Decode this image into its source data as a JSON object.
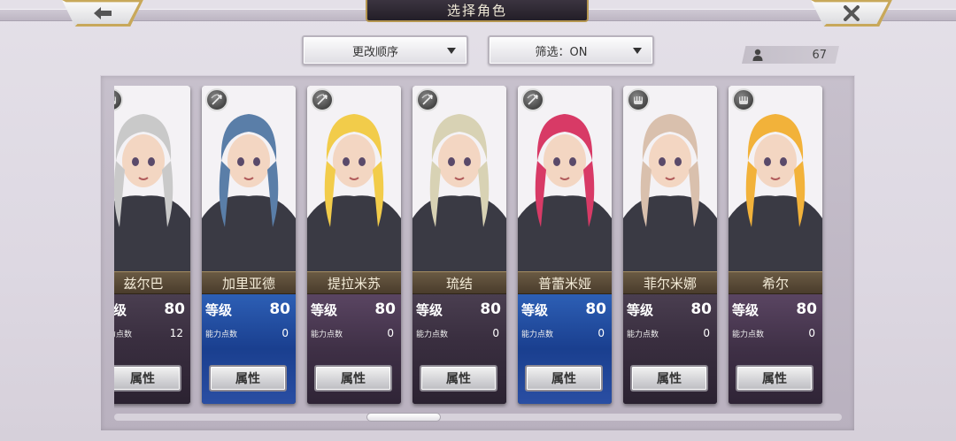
{
  "header": {
    "title": "选择角色",
    "back_icon": "back-arrow-icon",
    "close_icon": "close-x-icon"
  },
  "toolbar": {
    "sort_label": "更改顺序",
    "filter_label": "筛选：ON",
    "roster_count": "67"
  },
  "colors": {
    "gold_trim": "#c8a85a",
    "title_plate": "#2b252f",
    "blue_card": "#1a3f8f",
    "name_plate": "#5a4a38"
  },
  "labels": {
    "level": "等级",
    "ability_points": "能力点数",
    "attribute_button": "属性"
  },
  "characters": [
    {
      "name": "兹尔巴",
      "level": "80",
      "points": "12",
      "class_icon": "fist-icon",
      "hair": "#c9c9c9",
      "bg": "dark"
    },
    {
      "name": "加里亚德",
      "level": "80",
      "points": "0",
      "class_icon": "bow-icon",
      "hair": "#5a7ea8",
      "bg": "blue"
    },
    {
      "name": "提拉米苏",
      "level": "80",
      "points": "0",
      "class_icon": "bow-icon",
      "hair": "#f2cc4a",
      "bg": "purple"
    },
    {
      "name": "琉结",
      "level": "80",
      "points": "0",
      "class_icon": "bow-icon",
      "hair": "#d8d2b4",
      "bg": "dark"
    },
    {
      "name": "普蕾米娅",
      "level": "80",
      "points": "0",
      "class_icon": "bow-icon",
      "hair": "#d83a66",
      "bg": "blue"
    },
    {
      "name": "菲尔米娜",
      "level": "80",
      "points": "0",
      "class_icon": "fist-icon",
      "hair": "#d9c0ad",
      "bg": "dark"
    },
    {
      "name": "希尔",
      "level": "80",
      "points": "0",
      "class_icon": "fist-icon",
      "hair": "#f2b23a",
      "bg": "purple"
    }
  ]
}
